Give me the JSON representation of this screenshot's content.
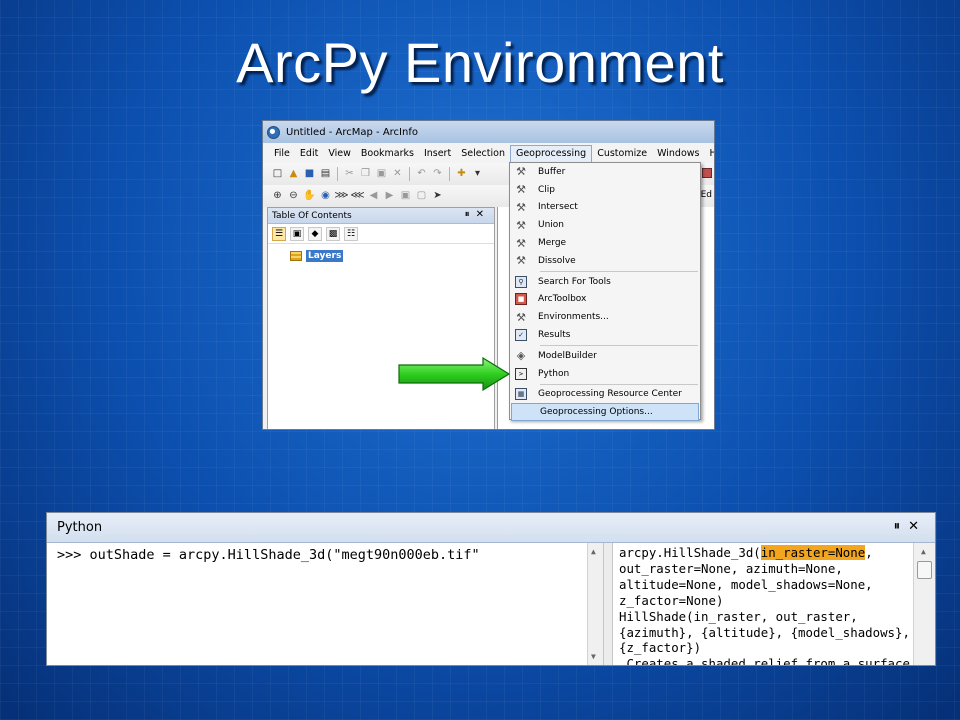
{
  "slide": {
    "title": "ArcPy Environment"
  },
  "arcmap": {
    "window_title": "Untitled - ArcMap - ArcInfo",
    "menu": [
      "File",
      "Edit",
      "View",
      "Bookmarks",
      "Insert",
      "Selection",
      "Geoprocessing",
      "Customize",
      "Windows",
      "He"
    ],
    "toolbar_right_label": "Ed",
    "toc": {
      "title": "Table Of Contents",
      "pin": "❁",
      "close": "✕",
      "layers_label": "Layers"
    }
  },
  "geoprocessing_menu": {
    "items": [
      {
        "label": "Buffer",
        "icon": "hammer-icon"
      },
      {
        "label": "Clip",
        "icon": "hammer-icon"
      },
      {
        "label": "Intersect",
        "icon": "hammer-icon"
      },
      {
        "label": "Union",
        "icon": "hammer-icon"
      },
      {
        "label": "Merge",
        "icon": "hammer-icon"
      },
      {
        "label": "Dissolve",
        "icon": "hammer-icon"
      },
      {
        "label": "Search For Tools",
        "icon": "search-tools-icon"
      },
      {
        "label": "ArcToolbox",
        "icon": "toolbox-icon"
      },
      {
        "label": "Environments...",
        "icon": "environments-icon"
      },
      {
        "label": "Results",
        "icon": "results-icon"
      },
      {
        "label": "ModelBuilder",
        "icon": "modelbuilder-icon"
      },
      {
        "label": "Python",
        "icon": "python-window-icon"
      },
      {
        "label": "Geoprocessing Resource Center",
        "icon": "resource-center-icon"
      },
      {
        "label": "Geoprocessing Options...",
        "icon": ""
      }
    ],
    "highlighted": "Geoprocessing Options..."
  },
  "python_window": {
    "title": "Python",
    "input_line": ">>> outShade = arcpy.HillShade_3d(\"megt90n000eb.tif\"",
    "help": {
      "line1_prefix": "arcpy.HillShade_3d(",
      "line1_highlight": "in_raster=None",
      "line1_suffix": ",",
      "lines": [
        "out_raster=None, azimuth=None,",
        "altitude=None, model_shadows=None,",
        "z_factor=None)",
        "HillShade(in_raster, out_raster,",
        "{azimuth}, {altitude}, {model_shadows},",
        "{z_factor})",
        " Creates a shaded relief from a surface"
      ]
    }
  },
  "colors": {
    "slide_background": "#0c4fae",
    "arrow_green": "#2fcf1f",
    "help_highlight": "#f3a51e",
    "menu_highlight": "#cfe3f8"
  }
}
